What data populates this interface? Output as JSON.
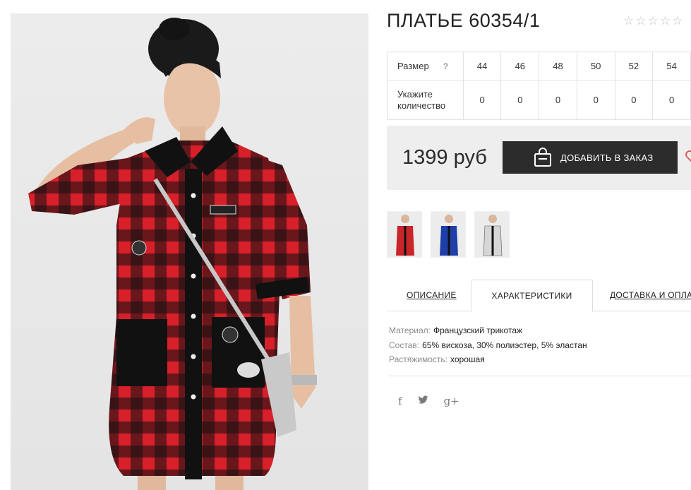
{
  "product": {
    "title": "ПЛАТЬЕ 60354/1",
    "rating_stars": [
      "☆",
      "☆",
      "☆",
      "☆",
      "☆"
    ],
    "rating_value": 0
  },
  "sizes": {
    "size_label": "Размер",
    "help_mark": "?",
    "values": [
      "44",
      "46",
      "48",
      "50",
      "52",
      "54"
    ],
    "qty_label": "Укажите количество",
    "quantities": [
      "0",
      "0",
      "0",
      "0",
      "0",
      "0"
    ]
  },
  "buy": {
    "price": "1399 руб",
    "order_label": "ДОБАВИТЬ В ЗАКАЗ",
    "icon": "shopping-bag-icon",
    "wish_icon": "heart-icon"
  },
  "thumbnails": [
    {
      "name": "red-plaid-dress",
      "color": "#c8262a"
    },
    {
      "name": "blue-plaid-dress",
      "color": "#1f3fa8"
    },
    {
      "name": "white-plaid-dress",
      "color": "#e9e9e9"
    }
  ],
  "tabs": [
    {
      "label": "ОПИСАНИЕ",
      "active": false
    },
    {
      "label": "ХАРАКТЕРИСТИКИ",
      "active": true
    },
    {
      "label": "ДОСТАВКА И ОПЛАТА",
      "active": false
    }
  ],
  "specs": [
    {
      "label": "Материал:",
      "value": "Французский трикотаж"
    },
    {
      "label": "Состав:",
      "value": "65% вискоза, 30% полиэстер, 5% эластан"
    },
    {
      "label": "Растяжимость:",
      "value": "хорошая"
    }
  ],
  "social": [
    {
      "name": "facebook-icon",
      "glyph": "f"
    },
    {
      "name": "twitter-icon",
      "glyph": "t"
    },
    {
      "name": "google-plus-icon",
      "glyph": "g+"
    }
  ],
  "colors": {
    "accent_dark": "#2c2c2c",
    "buybox_bg": "#eeeeee",
    "plaid_red": "#d8202a",
    "plaid_black": "#111111",
    "heart": "#d9534f"
  }
}
